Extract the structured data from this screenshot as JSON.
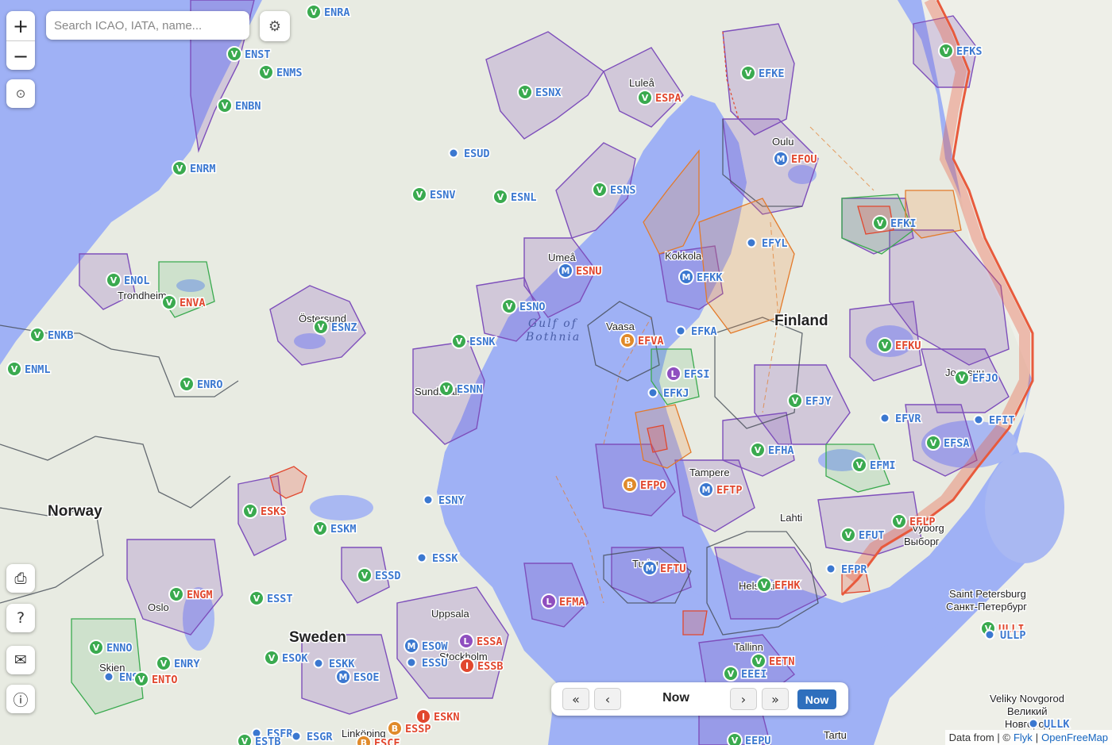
{
  "search": {
    "placeholder": "Search ICAO, IATA, name..."
  },
  "controls": {
    "zoom_in": "+",
    "zoom_out": "−",
    "settings_icon": "⚙",
    "locate_icon": "⊙",
    "layers_icon": "⎙",
    "help_icon": "?",
    "mail_icon": "✉",
    "info_icon": "ⓘ"
  },
  "timebar": {
    "first": "«",
    "prev": "‹",
    "label": "Now",
    "next": "›",
    "last": "»",
    "now_button": "Now"
  },
  "attribution": {
    "prefix": "Data from | ©",
    "flyk": "Flyk",
    "separator": "|",
    "ofm": "OpenFreeMap"
  },
  "colors": {
    "land": "#e8ebe2",
    "water": "#9fb1f5",
    "vfr": "#3aaa4f",
    "military": "#3b78d0",
    "restricted": "#e1472e",
    "border": "#e85a3c",
    "airspace_purple": "#7e4fbb"
  },
  "countries": [
    "Finland",
    "Norway",
    "Sweden"
  ],
  "seas": [
    "Gulf of",
    "Bothnia"
  ],
  "places": [
    "Luleå",
    "Oulu",
    "Umeå",
    "Kokkola",
    "Vaasa",
    "Östersund",
    "Trondheim",
    "Sundsvall",
    "Tampere",
    "Lahti",
    "Vyborg",
    "Выборг",
    "Turku",
    "Helsinki",
    "Uppsala",
    "Stockholm",
    "Oslo",
    "Skien",
    "Tallinn",
    "Linköping",
    "Saint Petersburg",
    "Санкт-Петербург",
    "Veliky Novgorod",
    "Великий",
    "Новгород",
    "Tartu",
    "Joensuu"
  ],
  "airports": [
    {
      "code": "ENRA",
      "kind": "V"
    },
    {
      "code": "ENST",
      "kind": "V"
    },
    {
      "code": "ENMS",
      "kind": "V"
    },
    {
      "code": "ENBN",
      "kind": "V"
    },
    {
      "code": "ENRM",
      "kind": "V"
    },
    {
      "code": "ENOL",
      "kind": "V"
    },
    {
      "code": "ENVA",
      "kind": "V"
    },
    {
      "code": "ENKB",
      "kind": "V"
    },
    {
      "code": "ENML",
      "kind": "V"
    },
    {
      "code": "ENRO",
      "kind": "V"
    },
    {
      "code": "ENGM",
      "kind": "V"
    },
    {
      "code": "ENNO",
      "kind": "V"
    },
    {
      "code": "ENRY",
      "kind": "V"
    },
    {
      "code": "ENSN",
      "kind": "dot"
    },
    {
      "code": "ENTO",
      "kind": "V"
    },
    {
      "code": "ESNX",
      "kind": "V"
    },
    {
      "code": "ESPA",
      "kind": "V"
    },
    {
      "code": "ESUD",
      "kind": "dot"
    },
    {
      "code": "ESNV",
      "kind": "V"
    },
    {
      "code": "ESNL",
      "kind": "V"
    },
    {
      "code": "ESNS",
      "kind": "V"
    },
    {
      "code": "ESNU",
      "kind": "M"
    },
    {
      "code": "ESNO",
      "kind": "V"
    },
    {
      "code": "ESNZ",
      "kind": "V"
    },
    {
      "code": "ESNK",
      "kind": "V"
    },
    {
      "code": "ESNN",
      "kind": "V"
    },
    {
      "code": "ESNY",
      "kind": "dot"
    },
    {
      "code": "ESKS",
      "kind": "V"
    },
    {
      "code": "ESKM",
      "kind": "V"
    },
    {
      "code": "ESSK",
      "kind": "dot"
    },
    {
      "code": "ESSD",
      "kind": "V"
    },
    {
      "code": "ESST",
      "kind": "V"
    },
    {
      "code": "ESOW",
      "kind": "M"
    },
    {
      "code": "ESSA",
      "kind": "L"
    },
    {
      "code": "ESOK",
      "kind": "V"
    },
    {
      "code": "ESKK",
      "kind": "dot"
    },
    {
      "code": "ESSU",
      "kind": "dot"
    },
    {
      "code": "ESSB",
      "kind": "I"
    },
    {
      "code": "ESOE",
      "kind": "M"
    },
    {
      "code": "ESKN",
      "kind": "I"
    },
    {
      "code": "ESSP",
      "kind": "B"
    },
    {
      "code": "ESFR",
      "kind": "dot"
    },
    {
      "code": "ESGR",
      "kind": "dot"
    },
    {
      "code": "ESTB",
      "kind": "V"
    },
    {
      "code": "ESCF",
      "kind": "B"
    },
    {
      "code": "EFKS",
      "kind": "V"
    },
    {
      "code": "EFKE",
      "kind": "V"
    },
    {
      "code": "EFOU",
      "kind": "M"
    },
    {
      "code": "EFKI",
      "kind": "V"
    },
    {
      "code": "EFYL",
      "kind": "dot"
    },
    {
      "code": "EFKK",
      "kind": "M"
    },
    {
      "code": "EFKA",
      "kind": "dot"
    },
    {
      "code": "EFVA",
      "kind": "B"
    },
    {
      "code": "EFSI",
      "kind": "L"
    },
    {
      "code": "EFKJ",
      "kind": "dot"
    },
    {
      "code": "EFKU",
      "kind": "V"
    },
    {
      "code": "EFJO",
      "kind": "V"
    },
    {
      "code": "EFJY",
      "kind": "V"
    },
    {
      "code": "EFVR",
      "kind": "dot"
    },
    {
      "code": "EFIT",
      "kind": "dot"
    },
    {
      "code": "EFSA",
      "kind": "V"
    },
    {
      "code": "EFHA",
      "kind": "V"
    },
    {
      "code": "EFMI",
      "kind": "V"
    },
    {
      "code": "EFPO",
      "kind": "B"
    },
    {
      "code": "EFTP",
      "kind": "M"
    },
    {
      "code": "EFLP",
      "kind": "V"
    },
    {
      "code": "EFUT",
      "kind": "V"
    },
    {
      "code": "EFPR",
      "kind": "dot"
    },
    {
      "code": "EFTU",
      "kind": "M"
    },
    {
      "code": "EFHK",
      "kind": "V"
    },
    {
      "code": "EFMA",
      "kind": "L"
    },
    {
      "code": "EETN",
      "kind": "V"
    },
    {
      "code": "EEEI",
      "kind": "V"
    },
    {
      "code": "EEPU",
      "kind": "V"
    },
    {
      "code": "ULLI",
      "kind": "V"
    },
    {
      "code": "ULLP",
      "kind": "dot"
    },
    {
      "code": "ULLK",
      "kind": "dot"
    }
  ]
}
